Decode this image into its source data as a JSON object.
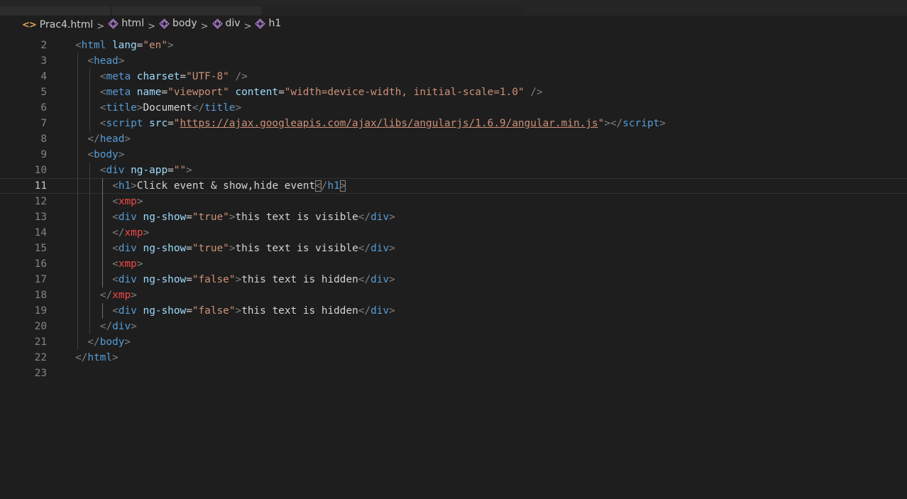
{
  "breadcrumb": {
    "file": "Prac4.html",
    "separator": ">",
    "items": [
      "html",
      "body",
      "div",
      "h1"
    ]
  },
  "icons": {
    "file": "html-file-icon",
    "symbol": "symbol-element-icon"
  },
  "colors": {
    "background": "#1e1e1e",
    "tag": "#569cd6",
    "tag_invalid": "#f44747",
    "attribute": "#9cdcfe",
    "string": "#ce9178",
    "punctuation": "#808080",
    "text": "#d4d4d4",
    "line_number": "#858585"
  },
  "editor": {
    "current_line": 11,
    "lines": [
      {
        "n": "2",
        "indent": 0,
        "tokens": [
          [
            "p",
            "<"
          ],
          [
            "tg",
            "html"
          ],
          [
            "tx",
            " "
          ],
          [
            "at",
            "lang"
          ],
          [
            "tx",
            "="
          ],
          [
            "st",
            "\"en\""
          ],
          [
            "p",
            ">"
          ]
        ]
      },
      {
        "n": "3",
        "indent": 1,
        "tokens": [
          [
            "p",
            "<"
          ],
          [
            "tg",
            "head"
          ],
          [
            "p",
            ">"
          ]
        ]
      },
      {
        "n": "4",
        "indent": 2,
        "tokens": [
          [
            "p",
            "<"
          ],
          [
            "tg",
            "meta"
          ],
          [
            "tx",
            " "
          ],
          [
            "at",
            "charset"
          ],
          [
            "tx",
            "="
          ],
          [
            "st",
            "\"UTF-8\""
          ],
          [
            "tx",
            " "
          ],
          [
            "p",
            "/>"
          ]
        ]
      },
      {
        "n": "5",
        "indent": 2,
        "tokens": [
          [
            "p",
            "<"
          ],
          [
            "tg",
            "meta"
          ],
          [
            "tx",
            " "
          ],
          [
            "at",
            "name"
          ],
          [
            "tx",
            "="
          ],
          [
            "st",
            "\"viewport\""
          ],
          [
            "tx",
            " "
          ],
          [
            "at",
            "content"
          ],
          [
            "tx",
            "="
          ],
          [
            "st",
            "\"width=device-width, initial-scale=1.0\""
          ],
          [
            "tx",
            " "
          ],
          [
            "p",
            "/>"
          ]
        ]
      },
      {
        "n": "6",
        "indent": 2,
        "tokens": [
          [
            "p",
            "<"
          ],
          [
            "tg",
            "title"
          ],
          [
            "p",
            ">"
          ],
          [
            "tx",
            "Document"
          ],
          [
            "p",
            "</"
          ],
          [
            "tg",
            "title"
          ],
          [
            "p",
            ">"
          ]
        ]
      },
      {
        "n": "7",
        "indent": 2,
        "tokens": [
          [
            "p",
            "<"
          ],
          [
            "tg",
            "script"
          ],
          [
            "tx",
            " "
          ],
          [
            "at",
            "src"
          ],
          [
            "tx",
            "="
          ],
          [
            "st",
            "\""
          ],
          [
            "url",
            "https://ajax.googleapis.com/ajax/libs/angularjs/1.6.9/angular.min.js"
          ],
          [
            "st",
            "\""
          ],
          [
            "p",
            "></"
          ],
          [
            "tg",
            "script"
          ],
          [
            "p",
            ">"
          ]
        ]
      },
      {
        "n": "8",
        "indent": 1,
        "tokens": [
          [
            "p",
            "</"
          ],
          [
            "tg",
            "head"
          ],
          [
            "p",
            ">"
          ]
        ]
      },
      {
        "n": "9",
        "indent": 1,
        "tokens": [
          [
            "p",
            "<"
          ],
          [
            "tg",
            "body"
          ],
          [
            "p",
            ">"
          ]
        ]
      },
      {
        "n": "10",
        "indent": 2,
        "tokens": [
          [
            "p",
            "<"
          ],
          [
            "tg",
            "div"
          ],
          [
            "tx",
            " "
          ],
          [
            "at",
            "ng-app"
          ],
          [
            "tx",
            "="
          ],
          [
            "st",
            "\"\""
          ],
          [
            "p",
            ">"
          ]
        ]
      },
      {
        "n": "11",
        "indent": 3,
        "tokens": [
          [
            "p",
            "<"
          ],
          [
            "tg",
            "h1"
          ],
          [
            "p",
            ">"
          ],
          [
            "tx",
            "Click event & show,hide event"
          ],
          [
            "pb",
            "<"
          ],
          [
            "p",
            "/"
          ],
          [
            "tg",
            "h1"
          ],
          [
            "pb",
            ">"
          ]
        ]
      },
      {
        "n": "12",
        "indent": 3,
        "tokens": [
          [
            "p",
            "<"
          ],
          [
            "tr",
            "xmp"
          ],
          [
            "p",
            ">"
          ]
        ]
      },
      {
        "n": "13",
        "indent": 3,
        "tokens": [
          [
            "p",
            "<"
          ],
          [
            "tg",
            "div"
          ],
          [
            "tx",
            " "
          ],
          [
            "at",
            "ng-show"
          ],
          [
            "tx",
            "="
          ],
          [
            "st",
            "\"true\""
          ],
          [
            "p",
            ">"
          ],
          [
            "tx",
            "this text is visible"
          ],
          [
            "p",
            "</"
          ],
          [
            "tg",
            "div"
          ],
          [
            "p",
            ">"
          ]
        ]
      },
      {
        "n": "14",
        "indent": 3,
        "tokens": [
          [
            "p",
            "</"
          ],
          [
            "tr",
            "xmp"
          ],
          [
            "p",
            ">"
          ]
        ]
      },
      {
        "n": "15",
        "indent": 3,
        "tokens": [
          [
            "p",
            "<"
          ],
          [
            "tg",
            "div"
          ],
          [
            "tx",
            " "
          ],
          [
            "at",
            "ng-show"
          ],
          [
            "tx",
            "="
          ],
          [
            "st",
            "\"true\""
          ],
          [
            "p",
            ">"
          ],
          [
            "tx",
            "this text is visible"
          ],
          [
            "p",
            "</"
          ],
          [
            "tg",
            "div"
          ],
          [
            "p",
            ">"
          ]
        ]
      },
      {
        "n": "16",
        "indent": 3,
        "tokens": [
          [
            "p",
            "<"
          ],
          [
            "tr",
            "xmp"
          ],
          [
            "p",
            ">"
          ]
        ]
      },
      {
        "n": "17",
        "indent": 3,
        "tokens": [
          [
            "p",
            "<"
          ],
          [
            "tg",
            "div"
          ],
          [
            "tx",
            " "
          ],
          [
            "at",
            "ng-show"
          ],
          [
            "tx",
            "="
          ],
          [
            "st",
            "\"false\""
          ],
          [
            "p",
            ">"
          ],
          [
            "tx",
            "this text is hidden"
          ],
          [
            "p",
            "</"
          ],
          [
            "tg",
            "div"
          ],
          [
            "p",
            ">"
          ]
        ]
      },
      {
        "n": "18",
        "indent": 2,
        "tokens": [
          [
            "p",
            "</"
          ],
          [
            "tr",
            "xmp"
          ],
          [
            "p",
            ">"
          ]
        ]
      },
      {
        "n": "19",
        "indent": 3,
        "tokens": [
          [
            "p",
            "<"
          ],
          [
            "tg",
            "div"
          ],
          [
            "tx",
            " "
          ],
          [
            "at",
            "ng-show"
          ],
          [
            "tx",
            "="
          ],
          [
            "st",
            "\"false\""
          ],
          [
            "p",
            ">"
          ],
          [
            "tx",
            "this text is hidden"
          ],
          [
            "p",
            "</"
          ],
          [
            "tg",
            "div"
          ],
          [
            "p",
            ">"
          ]
        ]
      },
      {
        "n": "20",
        "indent": 2,
        "tokens": [
          [
            "p",
            "</"
          ],
          [
            "tg",
            "div"
          ],
          [
            "p",
            ">"
          ]
        ]
      },
      {
        "n": "21",
        "indent": 1,
        "tokens": [
          [
            "p",
            "</"
          ],
          [
            "tg",
            "body"
          ],
          [
            "p",
            ">"
          ]
        ]
      },
      {
        "n": "22",
        "indent": 0,
        "tokens": [
          [
            "p",
            "</"
          ],
          [
            "tg",
            "html"
          ],
          [
            "p",
            ">"
          ]
        ]
      },
      {
        "n": "23",
        "indent": 0,
        "tokens": []
      }
    ]
  }
}
